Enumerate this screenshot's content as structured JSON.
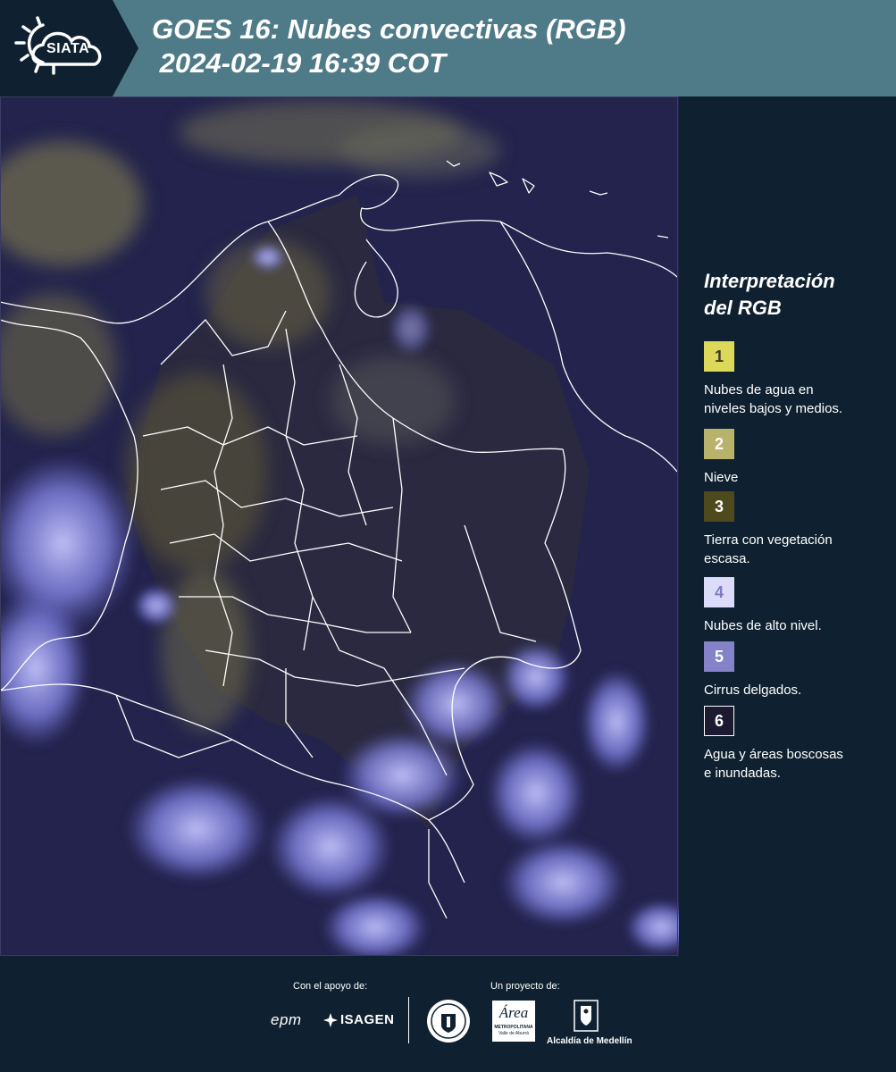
{
  "header": {
    "logo_text": "SIATA",
    "title": "GOES 16: Nubes convectivas (RGB)\n 2024-02-19 16:39 COT"
  },
  "map": {
    "description_icon": "satellite-rgb-map",
    "colors": {
      "background": "#23234d",
      "cloud_high": "#8a8cf0",
      "cloud_low": "#a8a468",
      "borders": "#ffffff"
    }
  },
  "legend": {
    "title": "Interpretación\ndel RGB",
    "items": [
      {
        "number": "1",
        "color": "#dcd85a",
        "text_color": "#3a3a20",
        "label": "Nubes de agua en\nniveles bajos y medios."
      },
      {
        "number": "2",
        "color": "#b8b26a",
        "text_color": "#ffffff",
        "label": "Nieve"
      },
      {
        "number": "3",
        "color": "#4e4a1e",
        "text_color": "#ffffff",
        "label": "Tierra con vegetación\nescasa."
      },
      {
        "number": "4",
        "color": "#dcdcfa",
        "text_color": "#7c7cc0",
        "label": "Nubes de alto nivel."
      },
      {
        "number": "5",
        "color": "#8482c8",
        "text_color": "#ffffff",
        "label": "Cirrus delgados."
      },
      {
        "number": "6",
        "color": "#1c1a30",
        "text_color": "#ffffff",
        "label": "Agua y áreas boscosas\ne inundadas."
      }
    ]
  },
  "footer": {
    "support_label": "Con el apoyo de:",
    "project_label": "Un proyecto de:",
    "partners": {
      "epm": "epm",
      "isagen": "ISAGEN"
    },
    "area_logo_text": "Área",
    "area_sub1": "METROPOLITANA",
    "area_sub2": "Valle de Aburrá",
    "alcaldia": "Alcaldía de Medellín",
    "seal_icon": "medellin-seal-icon"
  }
}
